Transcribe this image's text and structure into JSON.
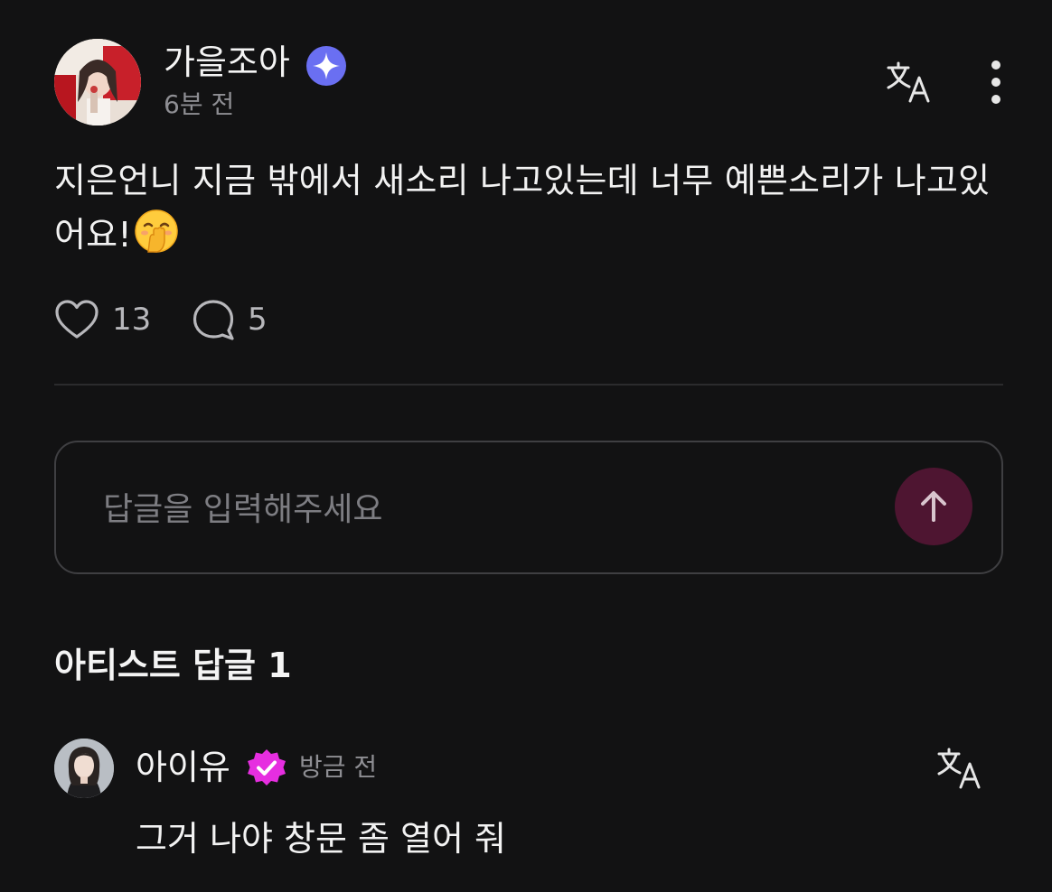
{
  "post": {
    "author": "가을조아",
    "time": "6분 전",
    "body": "지은언니 지금 밖에서 새소리 나고있는데 너무 예쁜소리가 나고있어요!",
    "emoji": "hand-over-mouth-emoji",
    "likes": "13",
    "comments": "5"
  },
  "icons": {
    "verified_author": "sparkle-verified-icon",
    "verified_artist": "checkmark-verified-icon",
    "translate": "translate-icon",
    "more": "more-vertical-icon",
    "like": "heart-icon",
    "comment": "comment-bubble-icon",
    "send": "arrow-up-icon"
  },
  "reply_input": {
    "placeholder": "답글을 입력해주세요"
  },
  "artist_replies": {
    "title": "아티스트 답글 1",
    "items": [
      {
        "author": "아이유",
        "time": "방금 전",
        "text": "그거 나야 창문 좀 열어 줘"
      }
    ]
  },
  "colors": {
    "background": "#121213",
    "verified_blue": "#6a6ff2",
    "verified_pink": "#e62ee0",
    "send_button": "#4e1531",
    "muted_text": "#8e8e93"
  }
}
